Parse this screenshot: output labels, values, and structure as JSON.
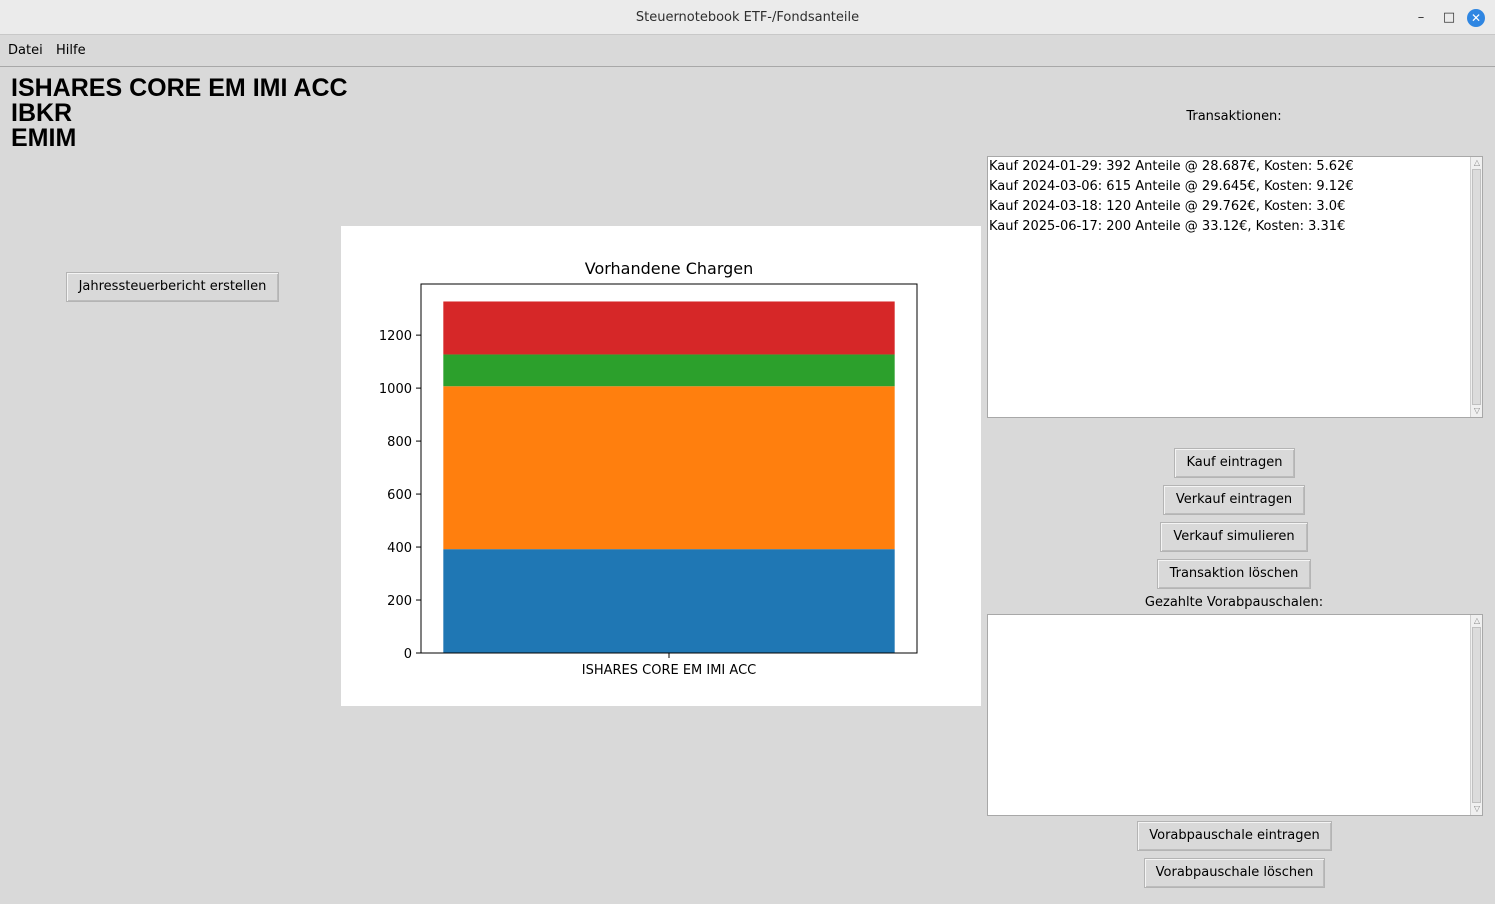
{
  "window": {
    "title": "Steuernotebook ETF-/Fondsanteile"
  },
  "menu": {
    "items": [
      "Datei",
      "Hilfe"
    ]
  },
  "fund": {
    "name": "ISHARES CORE EM IMI ACC",
    "broker": "IBKR",
    "ticker": "EMIM"
  },
  "left": {
    "annual_report_button": "Jahressteuerbericht erstellen"
  },
  "transactions": {
    "label": "Transaktionen:",
    "rows": [
      "Kauf 2024-01-29: 392 Anteile @ 28.687€, Kosten: 5.62€",
      "Kauf 2024-03-06: 615 Anteile @ 29.645€, Kosten: 9.12€",
      "Kauf 2024-03-18: 120 Anteile @ 29.762€, Kosten: 3.0€",
      "Kauf 2025-06-17: 200 Anteile @ 33.12€, Kosten: 3.31€"
    ],
    "buttons": {
      "buy": "Kauf eintragen",
      "sell": "Verkauf eintragen",
      "simulate": "Verkauf simulieren",
      "delete": "Transaktion löschen"
    }
  },
  "prepayments": {
    "label": "Gezahlte Vorabpauschalen:",
    "rows": [],
    "buttons": {
      "add": "Vorabpauschale eintragen",
      "delete": "Vorabpauschale löschen"
    }
  },
  "chart_data": {
    "type": "bar",
    "stacked": true,
    "title": "Vorhandene Chargen",
    "categories": [
      "ISHARES CORE EM IMI ACC"
    ],
    "series": [
      {
        "values": [
          392
        ],
        "color": "#1f77b4"
      },
      {
        "values": [
          615
        ],
        "color": "#ff7f0e"
      },
      {
        "values": [
          120
        ],
        "color": "#2ca02c"
      },
      {
        "values": [
          200
        ],
        "color": "#d62728"
      }
    ],
    "ylim": [
      0,
      1393
    ],
    "yticks": [
      0,
      200,
      400,
      600,
      800,
      1000,
      1200
    ],
    "xlabel": "",
    "ylabel": "",
    "grid": false,
    "legend": false
  }
}
